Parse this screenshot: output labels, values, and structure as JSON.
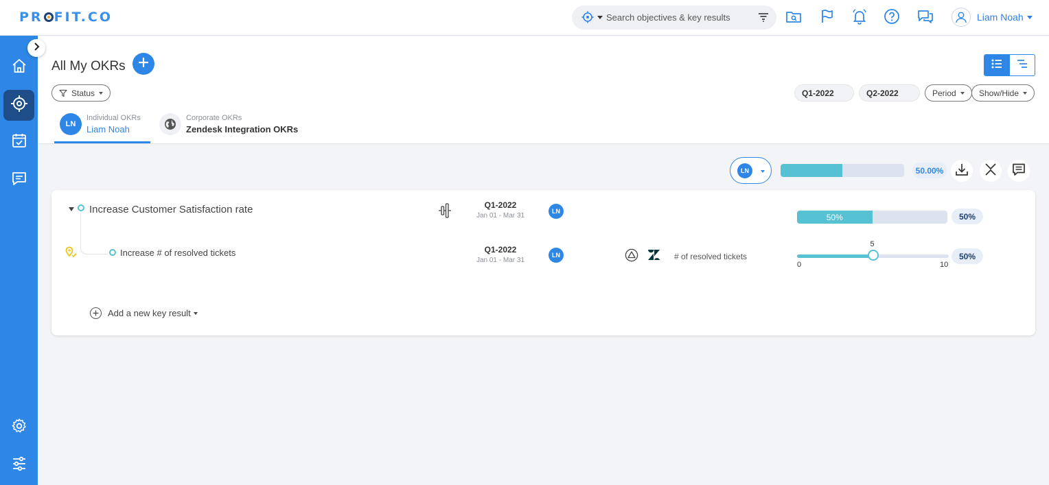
{
  "brand": {
    "logo_prefix": "PR",
    "logo_suffix": "FIT.CO"
  },
  "search": {
    "placeholder": "Search objectives & key results"
  },
  "user": {
    "name": "Liam Noah"
  },
  "page": {
    "title": "All My OKRs"
  },
  "filters": {
    "status_label": "Status",
    "quarters": [
      "Q1-2022",
      "Q2-2022"
    ],
    "period_label": "Period",
    "showhide_label": "Show/Hide"
  },
  "tabs": [
    {
      "sub": "Individual OKRs",
      "main": "Liam Noah",
      "initials": "LN",
      "active": true
    },
    {
      "sub": "Corporate OKRs",
      "main": "Zendesk Integration OKRs",
      "active": false
    }
  ],
  "summary": {
    "owner_initials": "LN",
    "progress": 50.0,
    "progress_label": "50.00%"
  },
  "objective": {
    "title": "Increase Customer Satisfaction rate",
    "period": "Q1-2022",
    "dates": "Jan 01 - Mar 31",
    "owner_initials": "LN",
    "progress": 50,
    "progress_label": "50%",
    "badge": "50%"
  },
  "key_result": {
    "title": "Increase # of resolved tickets",
    "period": "Q1-2022",
    "dates": "Jan 01 - Mar 31",
    "owner_initials": "LN",
    "metric_label": "# of resolved tickets",
    "min": 0,
    "max": 10,
    "current": 5,
    "min_label": "0",
    "max_label": "10",
    "current_label": "5",
    "badge": "50%"
  },
  "add_kr_label": "Add a new key result",
  "colors": {
    "brand_blue": "#2e87e6",
    "sidebar_active": "#1d4e89",
    "progress_teal": "#55c1d2"
  }
}
